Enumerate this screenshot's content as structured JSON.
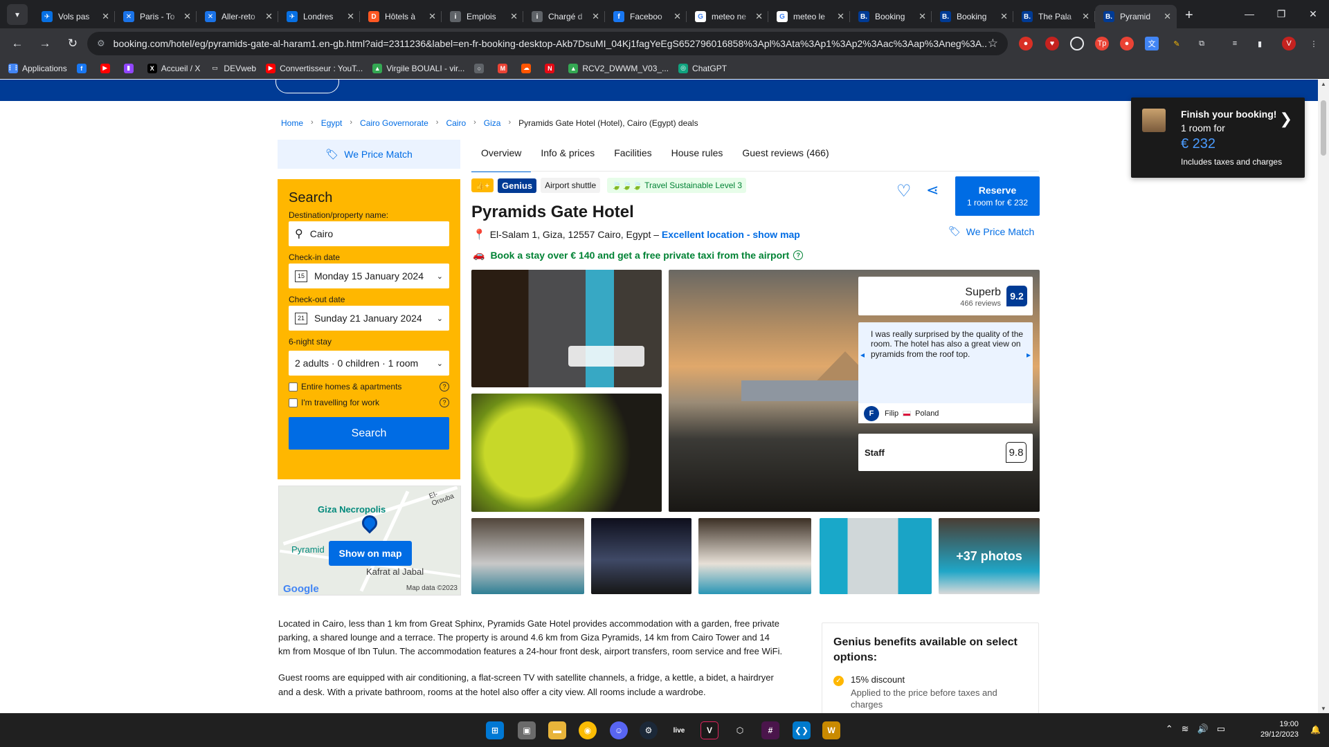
{
  "browser": {
    "tabs": [
      {
        "title": "Vols pas",
        "icon": "skyscanner-icon",
        "color": "#0770e3",
        "glyph": "✈"
      },
      {
        "title": "Paris - To",
        "icon": "kayak-icon",
        "color": "#1a73e8",
        "glyph": "✕"
      },
      {
        "title": "Aller-reto",
        "icon": "kayak-icon",
        "color": "#1a73e8",
        "glyph": "✕"
      },
      {
        "title": "Londres",
        "icon": "skyscanner-icon",
        "color": "#0770e3",
        "glyph": "✈"
      },
      {
        "title": "Hôtels à",
        "icon": "booking-d-icon",
        "color": "#ff5722",
        "glyph": "D"
      },
      {
        "title": "Emplois",
        "icon": "info-icon",
        "color": "#5f6368",
        "glyph": "i"
      },
      {
        "title": "Chargé d",
        "icon": "info-icon",
        "color": "#5f6368",
        "glyph": "i"
      },
      {
        "title": "Faceboo",
        "icon": "facebook-icon",
        "color": "#1877f2",
        "glyph": "f"
      },
      {
        "title": "meteo ne",
        "icon": "google-icon",
        "color": "#ffffff",
        "glyph": "G"
      },
      {
        "title": "meteo le",
        "icon": "google-icon",
        "color": "#ffffff",
        "glyph": "G"
      },
      {
        "title": "Booking",
        "icon": "booking-icon",
        "color": "#003b95",
        "glyph": "B."
      },
      {
        "title": "Booking",
        "icon": "booking-icon",
        "color": "#003b95",
        "glyph": "B."
      },
      {
        "title": "The Pala",
        "icon": "booking-icon",
        "color": "#003b95",
        "glyph": "B."
      },
      {
        "title": "Pyramid",
        "icon": "booking-icon",
        "color": "#003b95",
        "glyph": "B.",
        "active": true
      }
    ],
    "url": "booking.com/hotel/eg/pyramids-gate-al-haram1.en-gb.html?aid=2311236&label=en-fr-booking-desktop-Akb7DsuMI_04Kj1fagYeEgS652796016858%3Apl%3Ata%3Ap1%3Ap2%3Aac%3Aap%3Aneg%3A...",
    "bookmarks": [
      {
        "label": "Applications",
        "icon": "apps-grid-icon",
        "color": "#4285f4",
        "glyph": "⋮⋮"
      },
      {
        "label": "",
        "icon": "facebook-icon",
        "color": "#1877f2",
        "glyph": "f"
      },
      {
        "label": "",
        "icon": "youtube-icon",
        "color": "#ff0000",
        "glyph": "▶"
      },
      {
        "label": "",
        "icon": "twitch-icon",
        "color": "#9146ff",
        "glyph": "▮"
      },
      {
        "label": "Accueil / X",
        "icon": "x-icon",
        "color": "#000000",
        "glyph": "X"
      },
      {
        "label": "DEVweb",
        "icon": "folder-icon",
        "color": "#35363a",
        "glyph": "▭"
      },
      {
        "label": "Convertisseur : YouT...",
        "icon": "youtube-icon",
        "color": "#ff0000",
        "glyph": "▶"
      },
      {
        "label": "Virgile BOUALI - vir...",
        "icon": "google-drive-icon",
        "color": "#34a853",
        "glyph": "▲"
      },
      {
        "label": "",
        "icon": "circle-icon",
        "color": "#5f6368",
        "glyph": "○"
      },
      {
        "label": "",
        "icon": "gmail-icon",
        "color": "#ea4335",
        "glyph": "M"
      },
      {
        "label": "",
        "icon": "soundcloud-icon",
        "color": "#ff5500",
        "glyph": "☁"
      },
      {
        "label": "",
        "icon": "netflix-icon",
        "color": "#e50914",
        "glyph": "N"
      },
      {
        "label": "RCV2_DWWM_V03_...",
        "icon": "google-drive-icon",
        "color": "#34a853",
        "glyph": "▲"
      },
      {
        "label": "ChatGPT",
        "icon": "chatgpt-icon",
        "color": "#10a37f",
        "glyph": "◎"
      }
    ]
  },
  "breadcrumbs": [
    "Home",
    "Egypt",
    "Cairo Governorate",
    "Cairo",
    "Giza"
  ],
  "breadcrumb_current": "Pyramids Gate Hotel (Hotel), Cairo (Egypt) deals",
  "price_match": "We Price Match",
  "search": {
    "title": "Search",
    "destination_label": "Destination/property name:",
    "destination_value": "Cairo",
    "checkin_label": "Check-in date",
    "checkin_value": "Monday 15 January 2024",
    "checkout_label": "Check-out date",
    "checkout_value": "Sunday 21 January 2024",
    "stay_label": "6-night stay",
    "guests_value": "2 adults · 0 children · 1 room",
    "entire_homes": "Entire homes & apartments",
    "travelling_work": "I'm travelling for work",
    "button": "Search",
    "cal_day_in": "15",
    "cal_day_out": "21"
  },
  "map": {
    "button": "Show on map",
    "labels": {
      "necropolis": "Giza Necropolis",
      "pyramids": "Pyramid",
      "kafrat": "Kafrat al Jabal",
      "oroubah": "El-Orouba"
    },
    "copyright": "Map data ©2023",
    "provider": "Google"
  },
  "nav_tabs": [
    "Overview",
    "Info & prices",
    "Facilities",
    "House rules",
    "Guest reviews (466)"
  ],
  "badges": {
    "genius": "Genius",
    "shuttle": "Airport shuttle",
    "sustainable": "Travel Sustainable Level 3"
  },
  "hotel": {
    "name": "Pyramids Gate Hotel",
    "address": "El-Salam 1, Giza, 12557 Cairo, Egypt –",
    "location_link": "Excellent location - show map",
    "taxi_promo": "Book a stay over € 140 and get a free private taxi from the airport"
  },
  "reserve": {
    "label": "Reserve",
    "sub": "1 room for € 232"
  },
  "rating": {
    "word": "Superb",
    "count": "466 reviews",
    "score": "9.2"
  },
  "review": {
    "text": "I was really surprised by the quality of the room. The hotel has also a great view on pyramids from the roof top.",
    "initial": "F",
    "name": "Filip",
    "country": "Poland"
  },
  "staff": {
    "label": "Staff",
    "score": "9.8"
  },
  "photos_more": "+37 photos",
  "description": [
    "Located in Cairo, less than 1 km from Great Sphinx, Pyramids Gate Hotel provides accommodation with a garden, free private parking, a shared lounge and a terrace. The property is around 4.6 km from Giza Pyramids, 14 km from Cairo Tower and 14 km from Mosque of Ibn Tulun. The accommodation features a 24-hour front desk, airport transfers, room service and free WiFi.",
    "Guest rooms are equipped with air conditioning, a flat-screen TV with satellite channels, a fridge, a kettle, a bidet, a hairdryer and a desk. With a private bathroom, rooms at the hotel also offer a city view. All rooms include a wardrobe."
  ],
  "genius": {
    "title": "Genius benefits available on select options:",
    "item": "15% discount",
    "sub": "Applied to the price before taxes and charges"
  },
  "finish": {
    "title": "Finish your booking!",
    "line": "1 room for",
    "price": "€ 232",
    "note": "Includes taxes and charges"
  },
  "taskbar": {
    "time": "19:00",
    "date": "29/12/2023",
    "live_label": "live"
  },
  "colors": {
    "brand_blue": "#003b95",
    "action_blue": "#006ce4",
    "genius_yellow": "#ffb700",
    "green": "#008234"
  }
}
